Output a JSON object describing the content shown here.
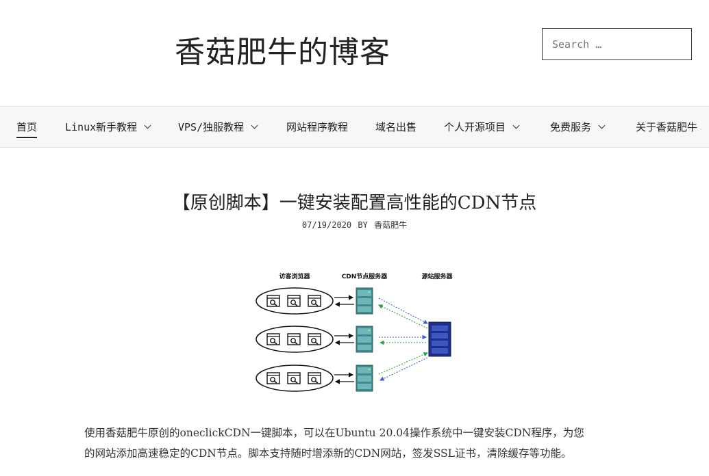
{
  "header": {
    "site_title": "香菇肥牛的博客",
    "search_placeholder": "Search …"
  },
  "nav": {
    "items": [
      {
        "label": "首页",
        "active": true,
        "has_dropdown": false
      },
      {
        "label": "Linux新手教程",
        "has_dropdown": true
      },
      {
        "label": "VPS/独服教程",
        "has_dropdown": true
      },
      {
        "label": "网站程序教程",
        "has_dropdown": false
      },
      {
        "label": "域名出售",
        "has_dropdown": false
      },
      {
        "label": "个人开源项目",
        "has_dropdown": true
      },
      {
        "label": "免费服务",
        "has_dropdown": true
      },
      {
        "label": "关于香菇肥牛",
        "has_dropdown": false
      }
    ]
  },
  "post": {
    "title": "【原创脚本】一键安装配置高性能的CDN节点",
    "date": "07/19/2020",
    "by": "BY",
    "author": "香菇肥牛",
    "figure": {
      "label_browsers": "访客浏览器",
      "label_cdn": "CDN节点服务器",
      "label_origin": "源站服务器"
    },
    "paragraph_line1": "使用香菇肥牛原创的oneclickCDN一键脚本，可以在Ubuntu 20.04操作系统中一键安装CDN程序，为您",
    "paragraph_line2": "的网站添加高速稳定的CDN节点。脚本支持随时增添新的CDN网站，签发SSL证书，清除缓存等功能。"
  },
  "colors": {
    "arrow_blue": "#3b5fc6",
    "arrow_green": "#2e9e3e",
    "origin_server": "#1e2f8c",
    "cdn_server": "#3f8a8c"
  }
}
